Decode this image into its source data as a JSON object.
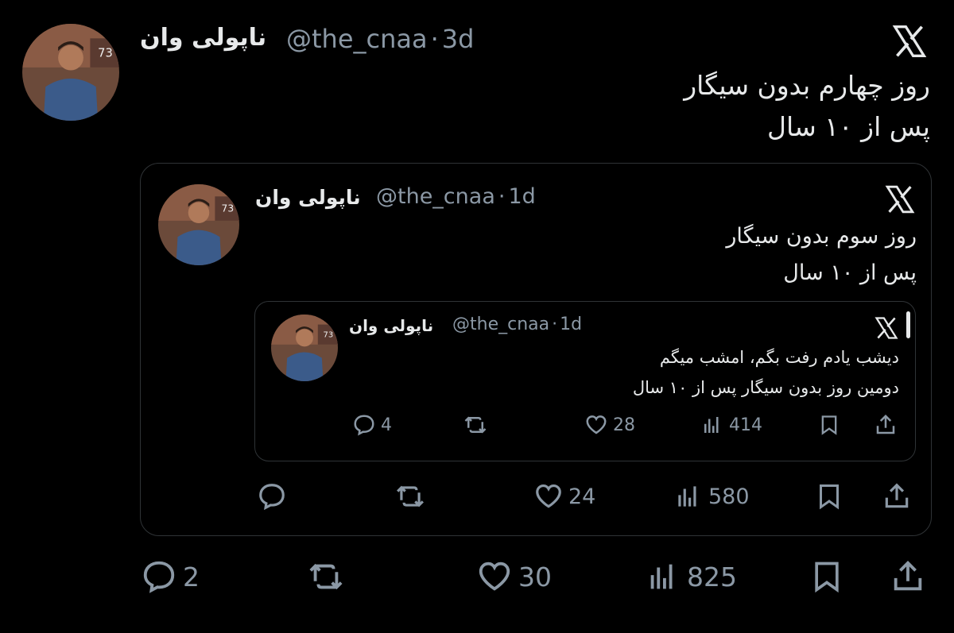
{
  "main": {
    "name": "ناپولی وان",
    "handle": "@the_cnaa",
    "time": "3d",
    "text_lines": [
      "روز چهارم بدون سیگار",
      "پس از ۱۰ سال"
    ],
    "stats": {
      "replies": "2",
      "reposts": "",
      "likes": "30",
      "views": "825"
    }
  },
  "quote1": {
    "name": "ناپولی وان",
    "handle": "@the_cnaa",
    "time": "1d",
    "text_lines": [
      "روز سوم بدون سیگار",
      "پس از ۱۰ سال"
    ],
    "stats": {
      "replies": "",
      "reposts": "",
      "likes": "24",
      "views": "580"
    }
  },
  "quote2": {
    "name": "ناپولی وان",
    "handle": "@the_cnaa",
    "time": "1d",
    "text_lines": [
      "دیشب یادم رفت بگم، امشب میگم",
      "دومین روز بدون سیگار پس از ۱۰ سال"
    ],
    "stats": {
      "replies": "4",
      "reposts": "",
      "likes": "28",
      "views": "414"
    }
  },
  "avatar_badge": "73",
  "separator": "·",
  "icons": [
    "x-logo-icon",
    "reply-icon",
    "repost-icon",
    "like-icon",
    "views-icon",
    "bookmark-icon",
    "share-icon"
  ]
}
